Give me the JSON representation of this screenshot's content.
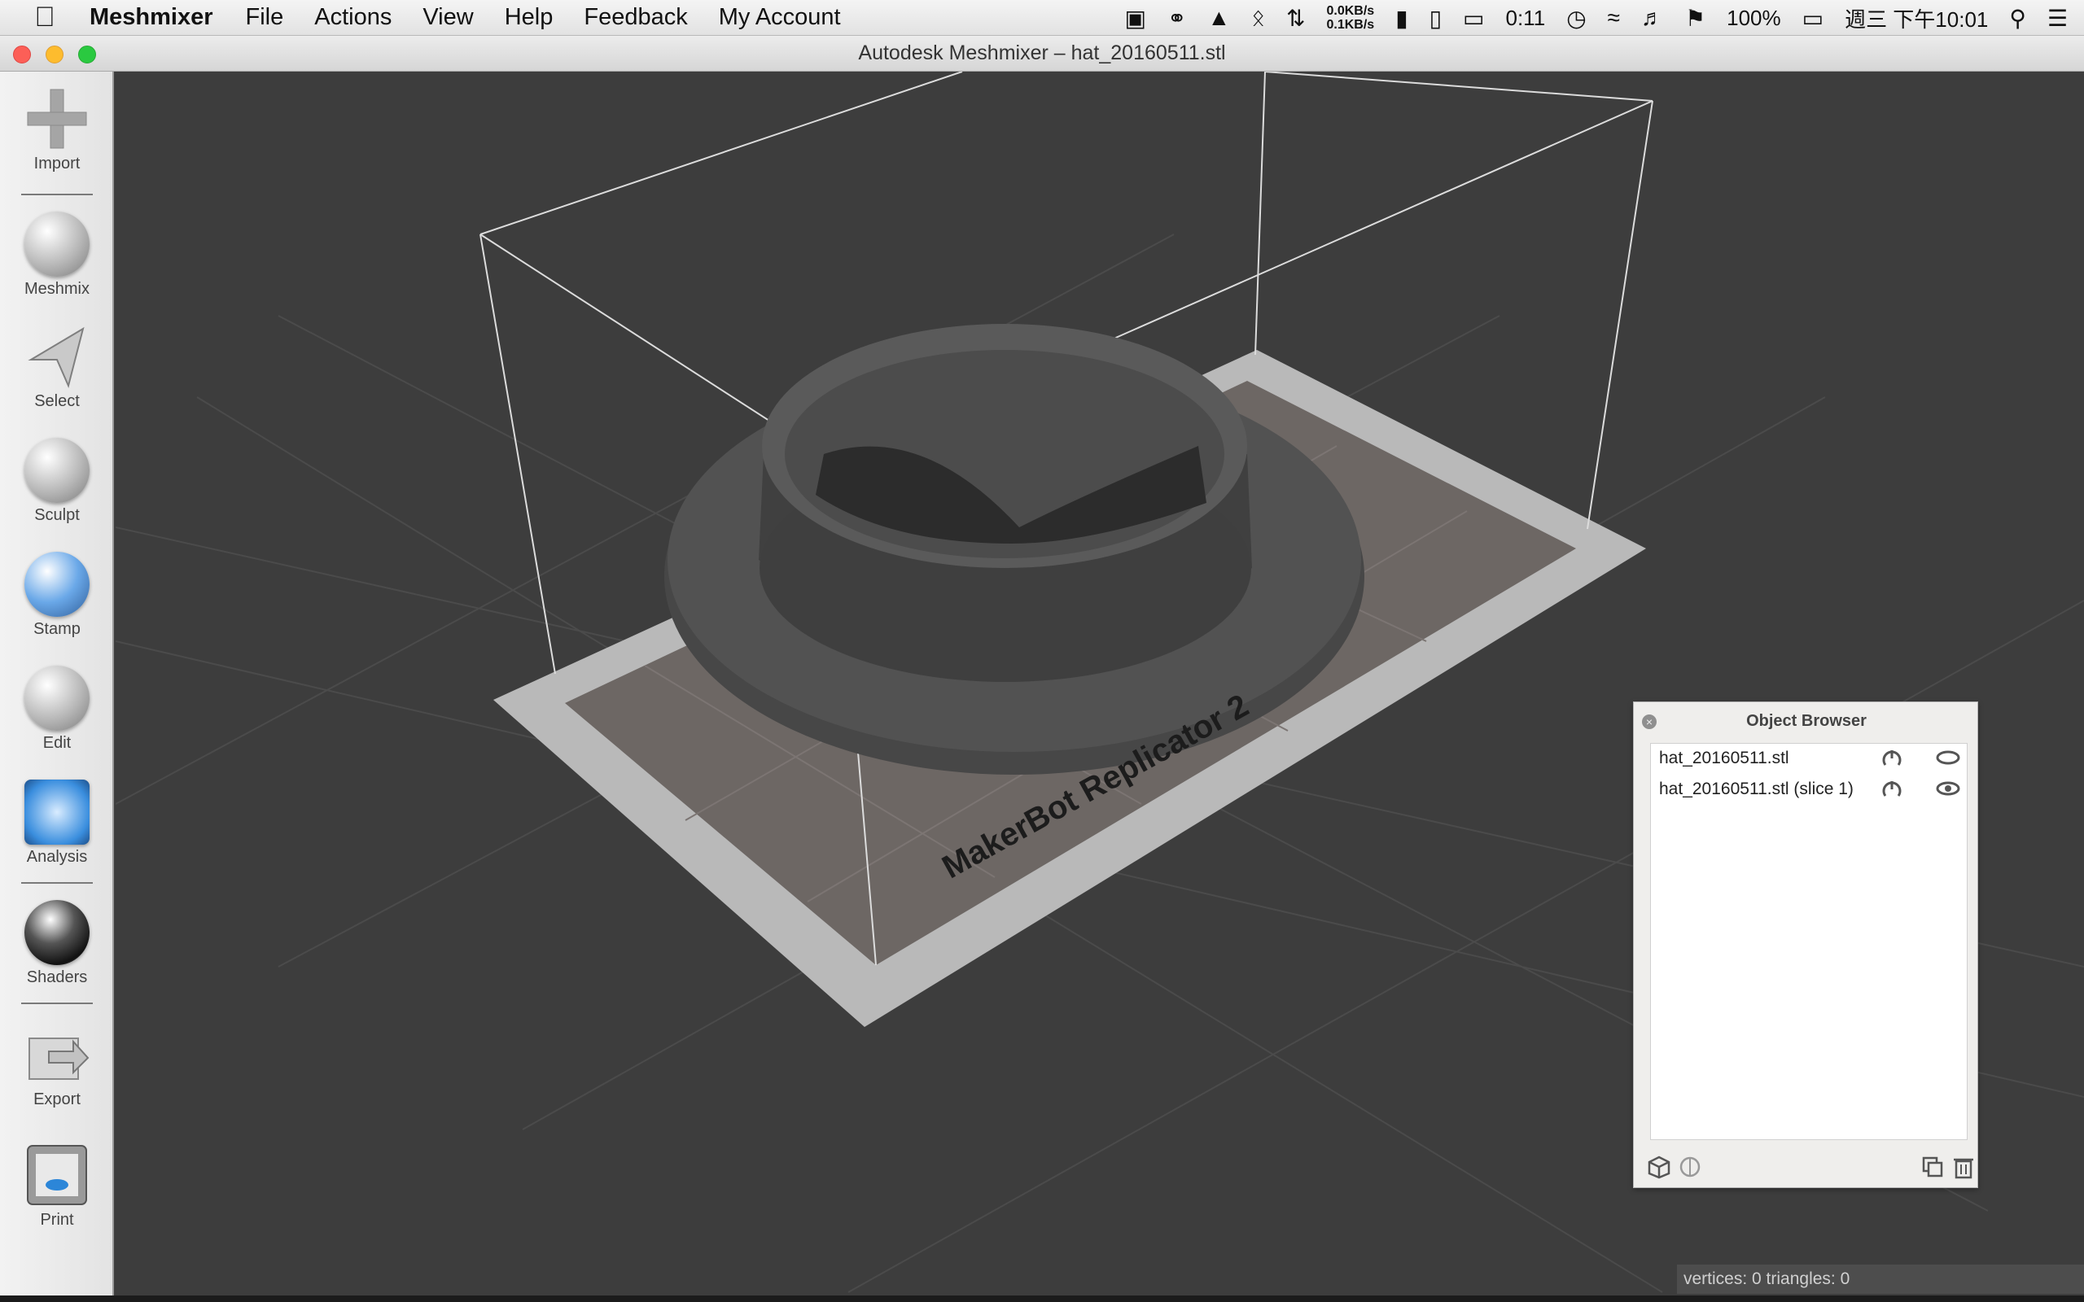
{
  "menubar": {
    "app_name": "Meshmixer",
    "items": [
      "File",
      "Actions",
      "View",
      "Help",
      "Feedback",
      "My Account"
    ],
    "net_down": "0.0KB/s",
    "net_up": "0.1KB/s",
    "timer": "0:11",
    "battery": "100%",
    "clock": "週三 下午10:01"
  },
  "window": {
    "title": "Autodesk Meshmixer – hat_20160511.stl"
  },
  "toolbar": {
    "items": [
      {
        "label": "Import"
      },
      {
        "label": "Meshmix"
      },
      {
        "label": "Select"
      },
      {
        "label": "Sculpt"
      },
      {
        "label": "Stamp"
      },
      {
        "label": "Edit"
      },
      {
        "label": "Analysis"
      },
      {
        "label": "Shaders"
      },
      {
        "label": "Export"
      },
      {
        "label": "Print"
      }
    ]
  },
  "viewport": {
    "printer_label": "MakerBot Replicator 2"
  },
  "object_browser": {
    "title": "Object Browser",
    "objects": [
      {
        "name": "hat_20160511.stl"
      },
      {
        "name": "hat_20160511.stl (slice 1)"
      }
    ]
  },
  "statusbar": {
    "text": "vertices: 0 triangles: 0"
  },
  "colors": {
    "viewport_bg": "#3d3d3d",
    "bed": "#b9b9b9",
    "model": "#4a4a4a"
  }
}
